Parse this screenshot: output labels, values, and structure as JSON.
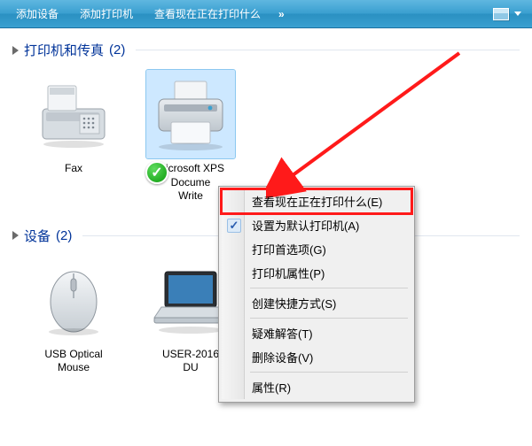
{
  "toolbar": {
    "addDevice": "添加设备",
    "addPrinter": "添加打印机",
    "seePrintQueue": "查看现在正在打印什么",
    "overflow": "»"
  },
  "sections": {
    "printers": {
      "title": "打印机和传真",
      "count": "(2)"
    },
    "devices": {
      "title": "设备",
      "count": "(2)"
    }
  },
  "printers": [
    {
      "label": "Fax",
      "type": "fax",
      "default": false
    },
    {
      "labelLine1": "Microsoft XPS",
      "labelLine2": "Docume",
      "labelLine3": "Write",
      "type": "printer",
      "default": true
    }
  ],
  "deviceItems": [
    {
      "labelLine1": "USB Optical",
      "labelLine2": "Mouse",
      "type": "mouse"
    },
    {
      "labelLine1": "USER-2016",
      "labelLine2": "DU",
      "type": "laptop"
    }
  ],
  "contextMenu": {
    "items": [
      {
        "text": "查看现在正在打印什么(E)",
        "highlight": true
      },
      {
        "text": "设置为默认打印机(A)",
        "checked": true
      },
      {
        "text": "打印首选项(G)"
      },
      {
        "text": "打印机属性(P)"
      },
      {
        "sep": true
      },
      {
        "text": "创建快捷方式(S)"
      },
      {
        "sep": true
      },
      {
        "text": "疑难解答(T)"
      },
      {
        "text": "删除设备(V)"
      },
      {
        "sep": true
      },
      {
        "text": "属性(R)"
      }
    ]
  }
}
